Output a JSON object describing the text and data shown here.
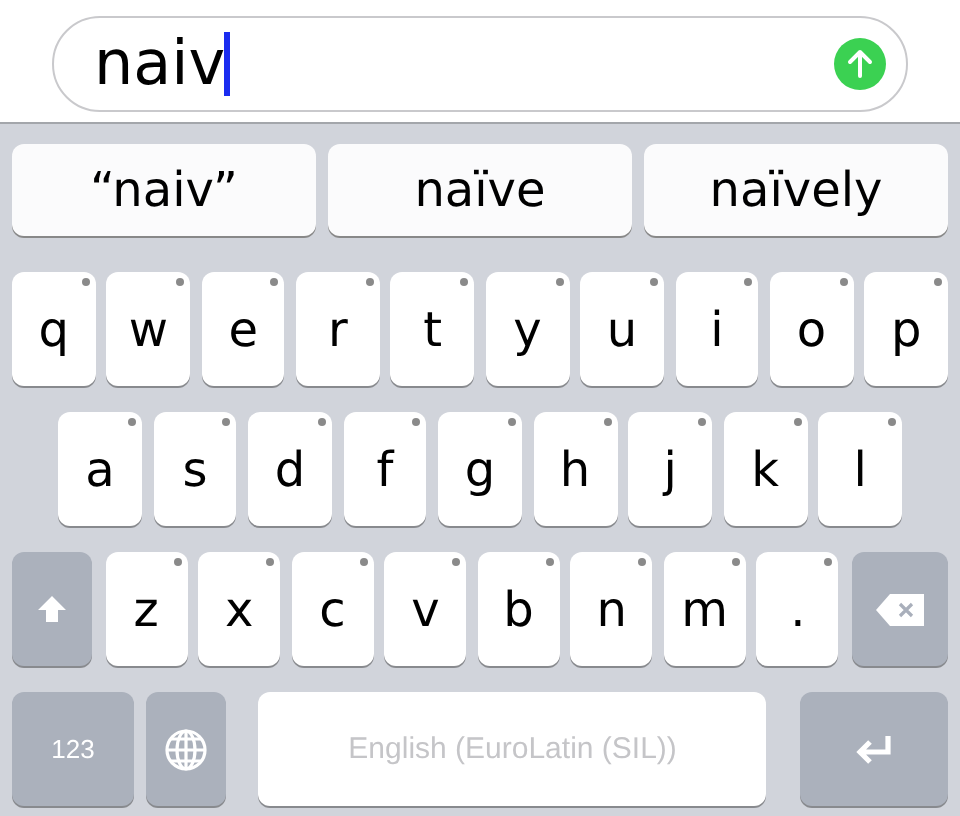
{
  "message_field": {
    "value": "naiv"
  },
  "suggestions": [
    {
      "text": "“naiv”"
    },
    {
      "text": "naïve"
    },
    {
      "text": "naïvely"
    }
  ],
  "keyboard": {
    "letter_rows": [
      {
        "keys": [
          {
            "kind": "letter",
            "label": "q"
          },
          {
            "kind": "letter",
            "label": "w"
          },
          {
            "kind": "letter",
            "label": "e"
          },
          {
            "kind": "letter",
            "label": "r"
          },
          {
            "kind": "letter",
            "label": "t"
          },
          {
            "kind": "letter",
            "label": "y"
          },
          {
            "kind": "letter",
            "label": "u"
          },
          {
            "kind": "letter",
            "label": "i"
          },
          {
            "kind": "letter",
            "label": "o"
          },
          {
            "kind": "letter",
            "label": "p"
          }
        ]
      },
      {
        "keys": [
          {
            "kind": "letter",
            "label": "a"
          },
          {
            "kind": "letter",
            "label": "s"
          },
          {
            "kind": "letter",
            "label": "d"
          },
          {
            "kind": "letter",
            "label": "f"
          },
          {
            "kind": "letter",
            "label": "g"
          },
          {
            "kind": "letter",
            "label": "h"
          },
          {
            "kind": "letter",
            "label": "j"
          },
          {
            "kind": "letter",
            "label": "k"
          },
          {
            "kind": "letter",
            "label": "l"
          }
        ]
      },
      {
        "keys": [
          {
            "kind": "shift"
          },
          {
            "kind": "letter",
            "label": "z"
          },
          {
            "kind": "letter",
            "label": "x"
          },
          {
            "kind": "letter",
            "label": "c"
          },
          {
            "kind": "letter",
            "label": "v"
          },
          {
            "kind": "letter",
            "label": "b"
          },
          {
            "kind": "letter",
            "label": "n"
          },
          {
            "kind": "letter",
            "label": "m"
          },
          {
            "kind": "letter",
            "label": "."
          },
          {
            "kind": "delete"
          }
        ]
      }
    ],
    "bottom_row": [
      {
        "kind": "numbers",
        "label": "123"
      },
      {
        "kind": "globe"
      },
      {
        "kind": "space",
        "label": "English (EuroLatin (SIL))"
      },
      {
        "kind": "return"
      }
    ]
  }
}
